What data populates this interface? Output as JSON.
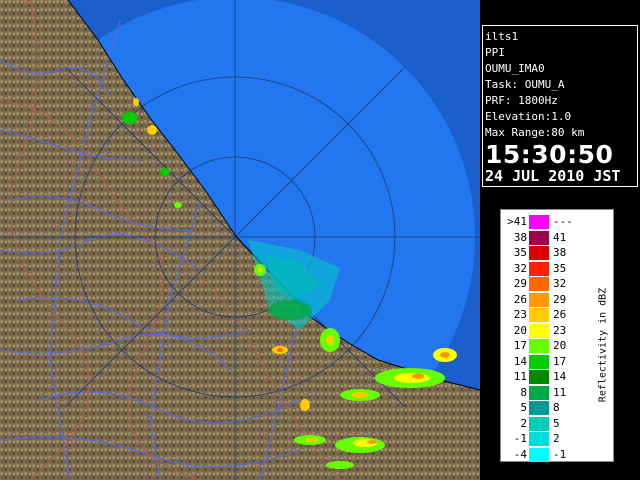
{
  "window": {
    "product": "ilts1",
    "scan_type": "PPI",
    "site": "OUMU_IMA0",
    "task": "Task: OUMU_A",
    "prf": "PRF: 1800Hz",
    "elevation": "Elevation:1.0",
    "max_range": "Max Range:80 km",
    "time": "15:30:50",
    "date": "24 JUL 2010 JST"
  },
  "legend": {
    "title": "Reflectivity in dBZ",
    "rows": [
      {
        "lo": ">41",
        "hi": "---",
        "color": "#ff00ff"
      },
      {
        "lo": "38",
        "hi": "41",
        "color": "#a0004a"
      },
      {
        "lo": "35",
        "hi": "38",
        "color": "#dd0000"
      },
      {
        "lo": "32",
        "hi": "35",
        "color": "#ff2000"
      },
      {
        "lo": "29",
        "hi": "32",
        "color": "#ff6600"
      },
      {
        "lo": "26",
        "hi": "29",
        "color": "#ff9900"
      },
      {
        "lo": "23",
        "hi": "26",
        "color": "#ffcc00"
      },
      {
        "lo": "20",
        "hi": "23",
        "color": "#ffff00"
      },
      {
        "lo": "17",
        "hi": "20",
        "color": "#66ff00"
      },
      {
        "lo": "14",
        "hi": "17",
        "color": "#00cc00"
      },
      {
        "lo": "11",
        "hi": "14",
        "color": "#008800"
      },
      {
        "lo": "8",
        "hi": "11",
        "color": "#00aa44"
      },
      {
        "lo": "5",
        "hi": "8",
        "color": "#009999"
      },
      {
        "lo": "2",
        "hi": "5",
        "color": "#00ccbb"
      },
      {
        "lo": "-1",
        "hi": "2",
        "color": "#00dddd"
      },
      {
        "lo": "-4",
        "hi": "-1",
        "color": "#00ffff"
      }
    ]
  },
  "map": {
    "sea_color": "#2277ee",
    "outer_sea_color": "#1a5fcc",
    "land_color": "#7a6a50",
    "river_color": "#5a6ad8",
    "boundary_color": "#b0604a"
  }
}
